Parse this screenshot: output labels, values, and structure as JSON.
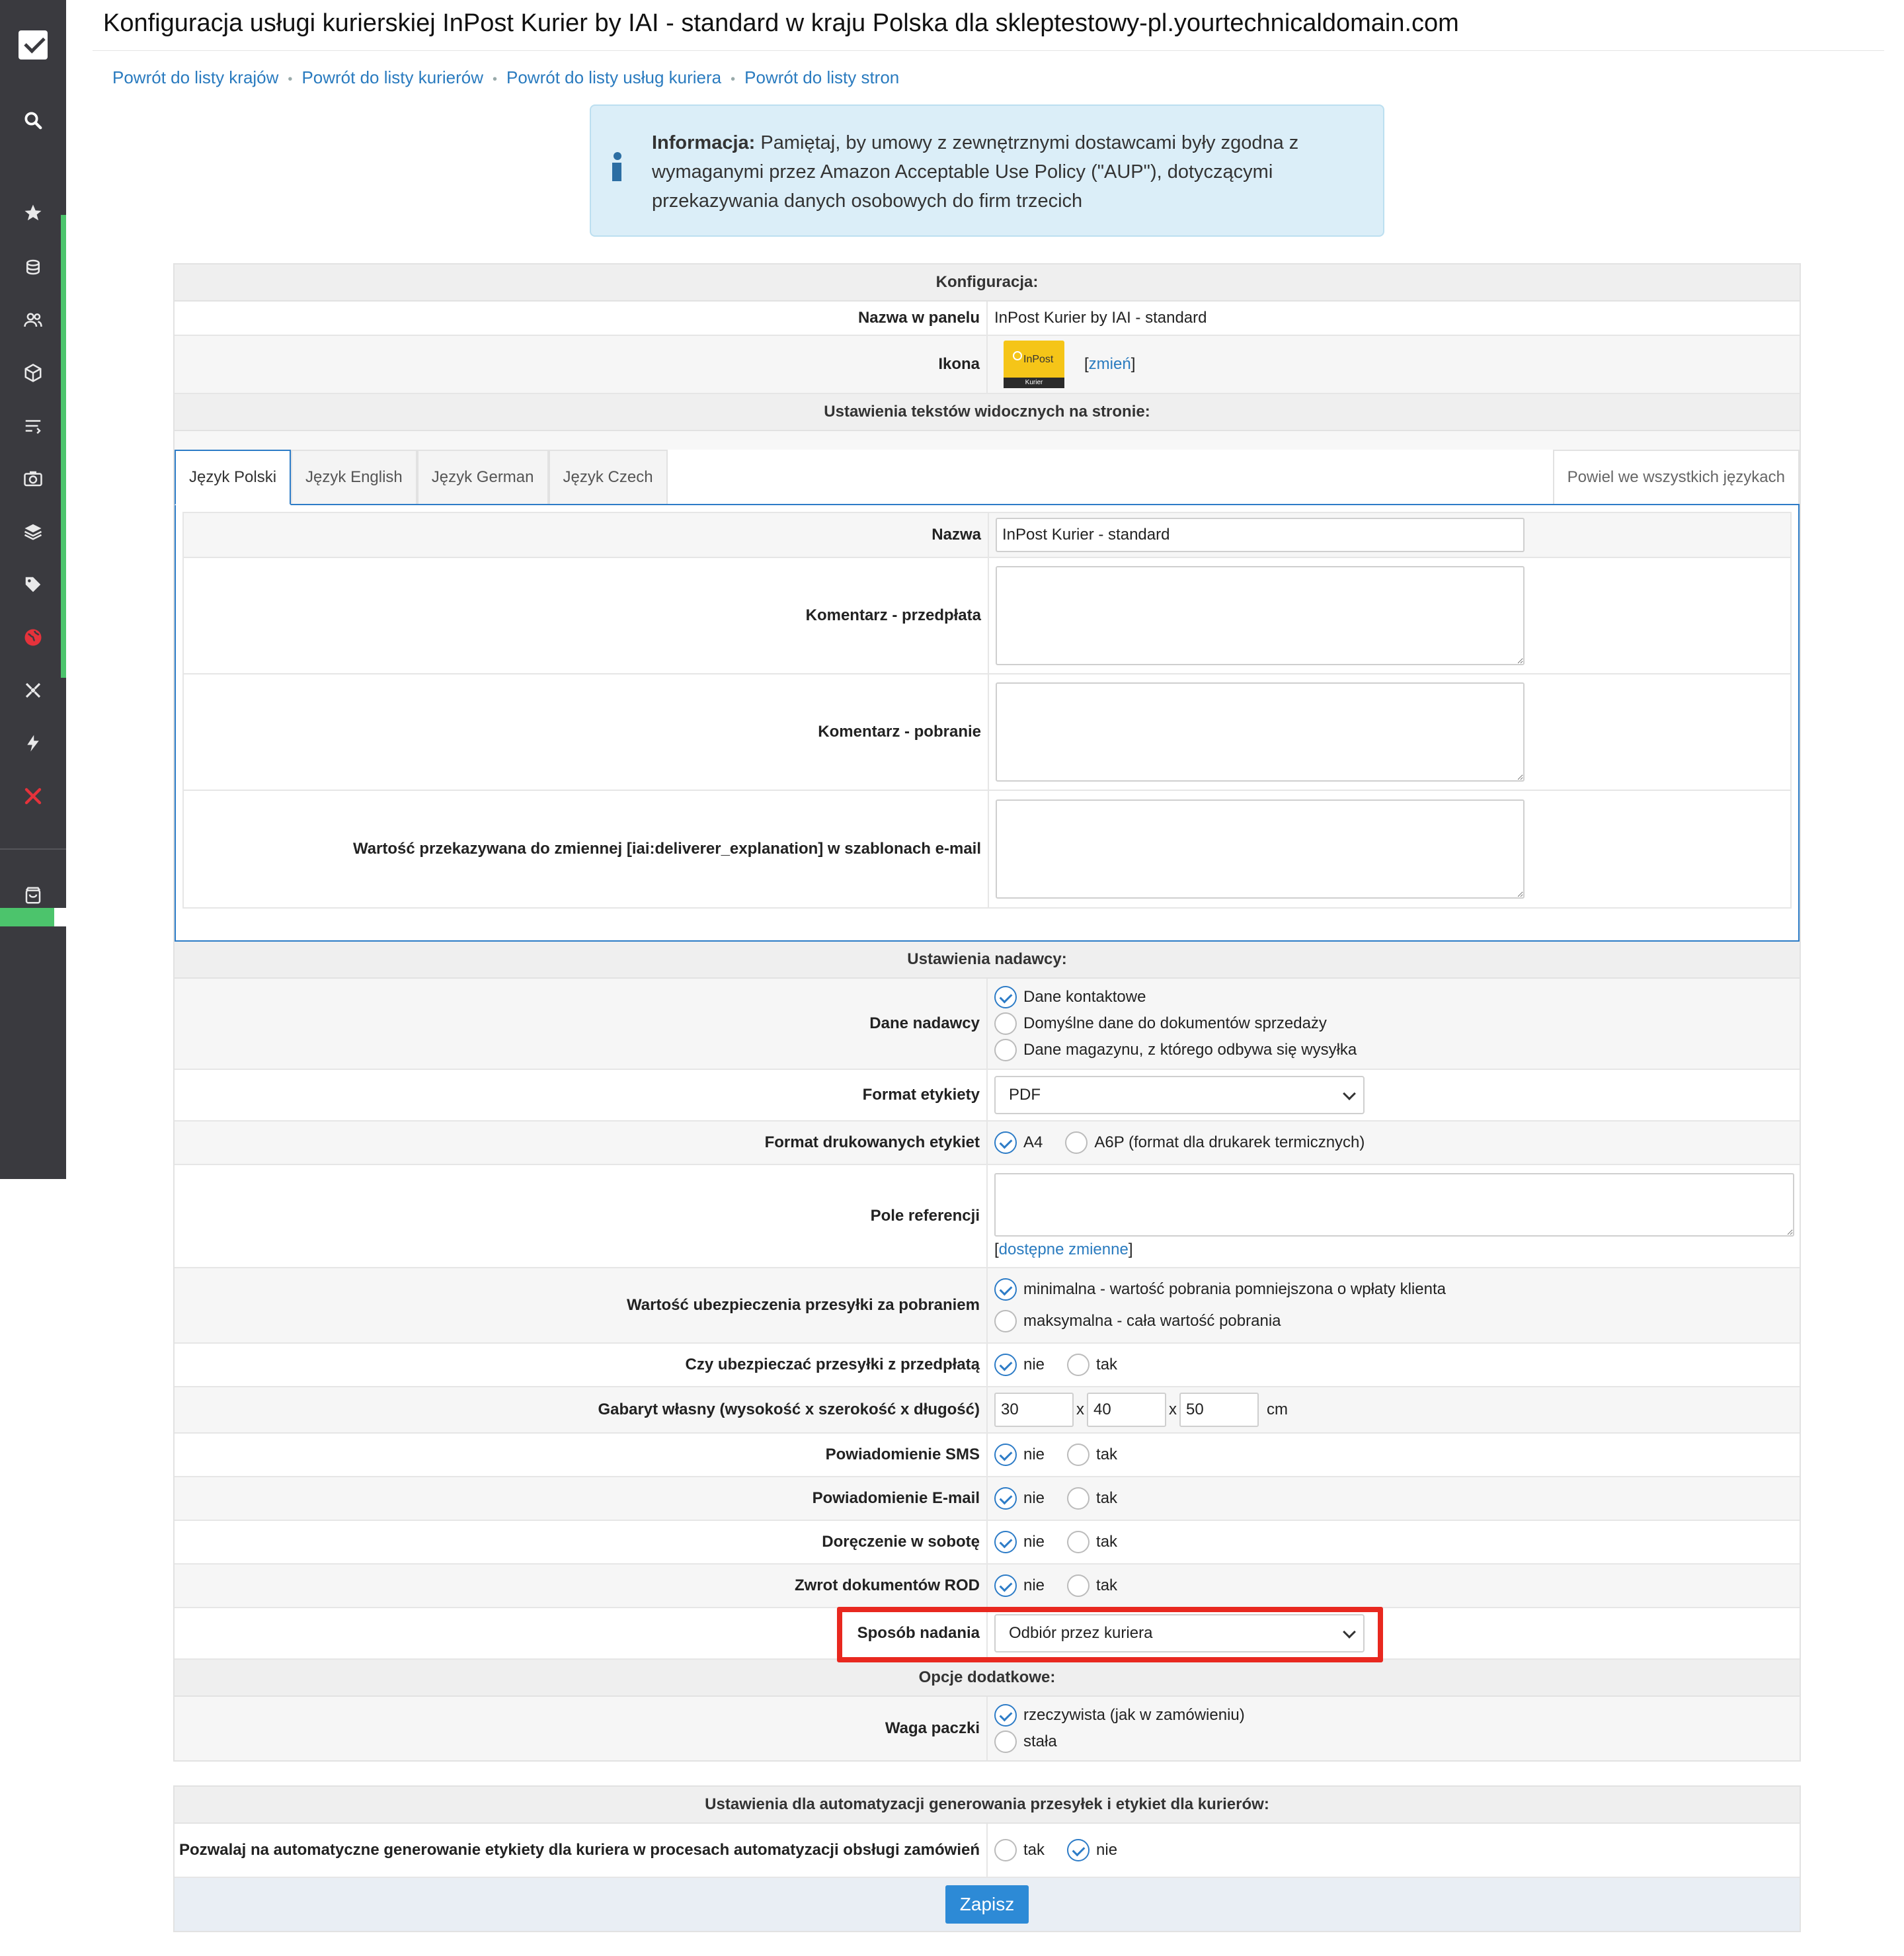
{
  "page": {
    "title": "Konfiguracja usługi kurierskiej InPost Kurier by IAI - standard w kraju Polska dla skleptestowy-pl.yourtechnicaldomain.com"
  },
  "breadcrumbs": [
    {
      "label": "Powrót do listy krajów"
    },
    {
      "label": "Powrót do listy kurierów"
    },
    {
      "label": "Powrót do listy usług kuriera"
    },
    {
      "label": "Powrót do listy stron"
    }
  ],
  "info": {
    "heading": "Informacja:",
    "text": " Pamiętaj, by umowy z zewnętrznymi dostawcami były zgodna z wymaganymi przez Amazon Acceptable Use Policy (\"AUP\"), dotyczącymi przekazywania danych osobowych do firm trzecich"
  },
  "config": {
    "section": "Konfiguracja:",
    "panel_name_label": "Nazwa w panelu",
    "panel_name_value": "InPost Kurier by IAI - standard",
    "icon_label": "Ikona",
    "icon_brand": "InPost",
    "icon_sub": "Kurier",
    "icon_change_link": "zmień",
    "icon_change_open": "[",
    "icon_change_close": "]"
  },
  "texts": {
    "section": "Ustawienia tekstów widocznych na stronie:",
    "tabs": [
      "Język Polski",
      "Język English",
      "Język German",
      "Język Czech"
    ],
    "copy_all": "Powiel we wszystkich językach",
    "name_label": "Nazwa",
    "name_value": "InPost Kurier - standard",
    "comment_prepay_label": "Komentarz - przedpłata",
    "comment_cod_label": "Komentarz - pobranie",
    "email_var_label": "Wartość przekazywana do zmiennej [iai:deliverer_explanation] w szablonach e-mail"
  },
  "sender": {
    "section": "Ustawienia nadawcy:",
    "sender_data_label": "Dane nadawcy",
    "sender_data_options": [
      "Dane kontaktowe",
      "Domyślne dane do dokumentów sprzedaży",
      "Dane magazynu, z którego odbywa się wysyłka"
    ],
    "label_format_label": "Format etykiety",
    "label_format_value": "PDF",
    "print_format_label": "Format drukowanych etykiet",
    "print_format_options": [
      "A4",
      "A6P (format dla drukarek termicznych)"
    ],
    "reference_label": "Pole referencji",
    "reference_link": "dostępne zmienne",
    "reference_open": "[",
    "reference_close": "]",
    "insurance_cod_label": "Wartość ubezpieczenia przesyłki za pobraniem",
    "insurance_cod_options": [
      "minimalna - wartość pobrania pomniejszona o wpłaty klienta",
      "maksymalna - cała wartość pobrania"
    ],
    "insure_prepaid_label": "Czy ubezpieczać przesyłki z przedpłatą",
    "no": "nie",
    "yes": "tak",
    "dims_label": "Gabaryt własny (wysokość x szerokość x długość)",
    "dims": [
      "30",
      "40",
      "50"
    ],
    "dims_sep": "x",
    "dims_unit": "cm",
    "sms_label": "Powiadomienie SMS",
    "email_label": "Powiadomienie E-mail",
    "saturday_label": "Doręczenie w sobotę",
    "rod_label": "Zwrot dokumentów ROD",
    "dispatch_label": "Sposób nadania",
    "dispatch_value": "Odbiór przez kuriera"
  },
  "extra": {
    "section": "Opcje dodatkowe:",
    "weight_label": "Waga paczki",
    "weight_options": [
      "rzeczywista (jak w zamówieniu)",
      "stała"
    ]
  },
  "automation": {
    "section": "Ustawienia dla automatyzacji generowania przesyłek i etykiet dla kurierów:",
    "allow_label": "Pozwalaj na automatyczne generowanie etykiety dla kuriera w procesach automatyzacji obsługi zamówień",
    "yes": "tak",
    "no": "nie",
    "save": "Zapisz"
  },
  "colors": {
    "sidebar": "#3a3a3f",
    "accent_green": "#4cc46c",
    "link": "#2a7bbf",
    "highlight": "#e8281f",
    "save_button": "#2d8ad6"
  }
}
